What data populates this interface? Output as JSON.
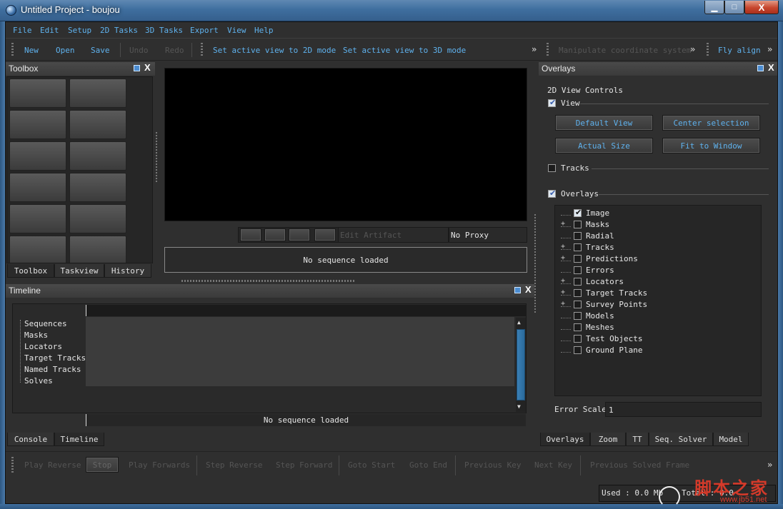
{
  "window": {
    "title": "Untitled Project - boujou",
    "min": "▁",
    "max": "□",
    "close": "X"
  },
  "menu": [
    "File",
    "Edit",
    "Setup",
    "2D Tasks",
    "3D Tasks",
    "Export",
    "View",
    "Help"
  ],
  "toolbar": {
    "new": "New",
    "open": "Open",
    "save": "Save",
    "undo": "Undo",
    "redo": "Redo",
    "set_2d": "Set active view to 2D mode",
    "set_3d": "Set active view to 3D mode",
    "more1": "»",
    "manipulate": "Manipulate coordinate system",
    "more2": "»",
    "fly_align": "Fly align",
    "more3": "»"
  },
  "toolbox": {
    "title": "Toolbox",
    "tabs": [
      "Toolbox",
      "Taskview",
      "History"
    ]
  },
  "viewer": {
    "edit_artifact": "Edit Artifact",
    "proxy": "No Proxy",
    "status": "No sequence loaded"
  },
  "timeline": {
    "title": "Timeline",
    "items": [
      "Sequences",
      "Masks",
      "Locators",
      "Target Tracks",
      "Named Tracks",
      "Solves"
    ],
    "status": "No sequence loaded"
  },
  "bottom_tabs": [
    "Console",
    "Timeline"
  ],
  "playback": {
    "play_reverse": "Play Reverse",
    "stop": "Stop",
    "play_forwards": "Play Forwards",
    "step_reverse": "Step Reverse",
    "step_forward": "Step Forward",
    "goto_start": "Goto Start",
    "goto_end": "Goto End",
    "previous_key": "Previous Key",
    "next_key": "Next Key",
    "previous_solved": "Previous Solved Frame",
    "more": "»"
  },
  "memory": {
    "used": "Used : 0.0 Mb",
    "total": "Total : 0.0"
  },
  "watermark": {
    "text": "脚本之家",
    "url": "www.jb51.net"
  },
  "overlays": {
    "title": "Overlays",
    "controls_label": "2D View Controls",
    "view_label": "View",
    "view_checked": true,
    "buttons": {
      "default_view": "Default View",
      "center_selection": "Center selection",
      "actual_size": "Actual Size",
      "fit_to_window": "Fit to Window"
    },
    "tracks_label": "Tracks",
    "tracks_checked": false,
    "overlays_label": "Overlays",
    "overlays_checked": true,
    "tree": [
      {
        "label": "Image",
        "checked": true,
        "expander": ""
      },
      {
        "label": "Masks",
        "checked": false,
        "expander": "+"
      },
      {
        "label": "Radial",
        "checked": false,
        "expander": ""
      },
      {
        "label": "Tracks",
        "checked": false,
        "expander": "+"
      },
      {
        "label": "Predictions",
        "checked": false,
        "expander": "+"
      },
      {
        "label": "Errors",
        "checked": false,
        "expander": ""
      },
      {
        "label": "Locators",
        "checked": false,
        "expander": "+"
      },
      {
        "label": "Target Tracks",
        "checked": false,
        "expander": "+"
      },
      {
        "label": "Survey Points",
        "checked": false,
        "expander": "+"
      },
      {
        "label": "Models",
        "checked": false,
        "expander": ""
      },
      {
        "label": "Meshes",
        "checked": false,
        "expander": ""
      },
      {
        "label": "Test Objects",
        "checked": false,
        "expander": ""
      },
      {
        "label": "Ground Plane",
        "checked": false,
        "expander": ""
      }
    ],
    "error_scale_label": "Error Scale",
    "error_scale_value": "1",
    "tabs": [
      "Overlays",
      "Zoom",
      "TT",
      "Seq. Solver",
      "Model"
    ]
  },
  "colors": {
    "accent": "#5fb2ee",
    "panel": "#2f2f2f",
    "viewport": "#000000"
  }
}
